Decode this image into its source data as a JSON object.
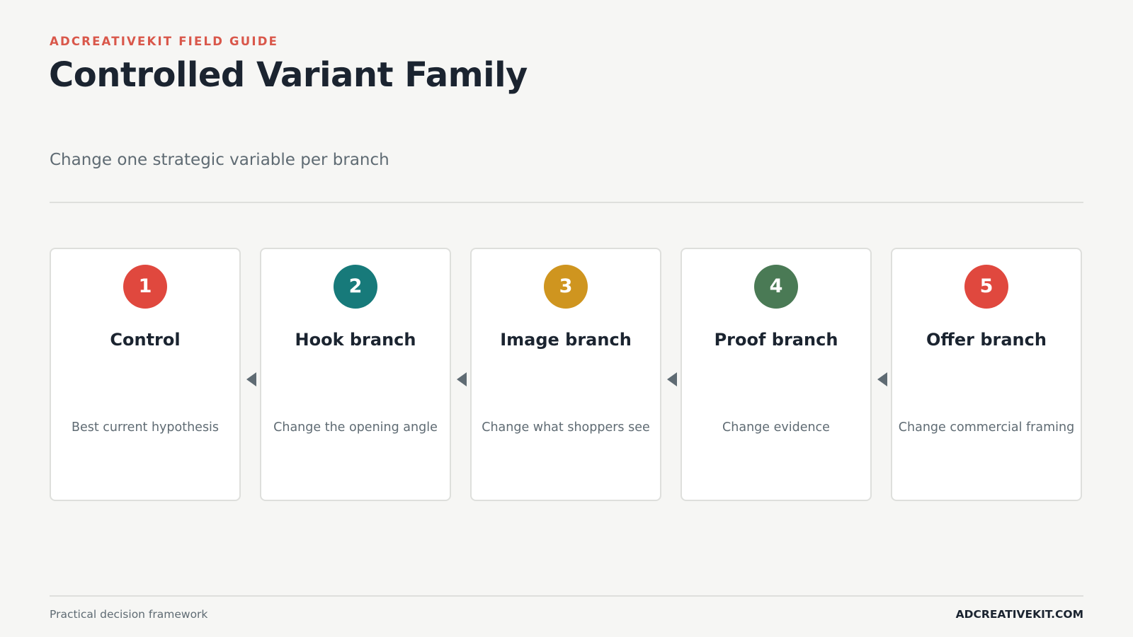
{
  "header": {
    "eyebrow": "ADCREATIVEKIT FIELD GUIDE",
    "title": "Controlled Variant Family",
    "subtitle": "Change one strategic variable per branch"
  },
  "steps": [
    {
      "number": "1",
      "title": "Control",
      "description": "Best current hypothesis",
      "color": "#e0483e"
    },
    {
      "number": "2",
      "title": "Hook branch",
      "description": "Change the opening angle",
      "color": "#177a7a"
    },
    {
      "number": "3",
      "title": "Image branch",
      "description": "Change what shoppers see",
      "color": "#cf951f"
    },
    {
      "number": "4",
      "title": "Proof branch",
      "description": "Change evidence",
      "color": "#4a7a55"
    },
    {
      "number": "5",
      "title": "Offer branch",
      "description": "Change commercial framing",
      "color": "#e0483e"
    }
  ],
  "connectors": {
    "icon": "arrow-left-icon",
    "color": "#5f6b73"
  },
  "footer": {
    "left": "Practical decision framework",
    "right": "ADCREATIVEKIT.COM"
  }
}
